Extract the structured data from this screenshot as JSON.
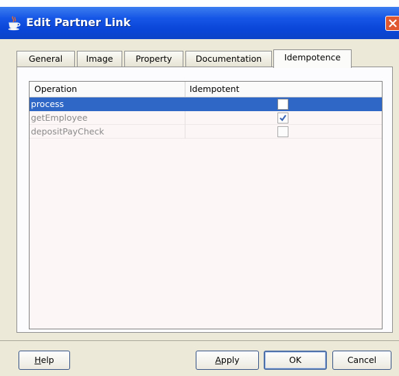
{
  "window": {
    "title": "Edit Partner Link"
  },
  "tabs": [
    "General",
    "Image",
    "Property",
    "Documentation",
    "Idempotence"
  ],
  "active_tab": "Idempotence",
  "table": {
    "columns": [
      "Operation",
      "Idempotent"
    ],
    "rows": [
      {
        "operation": "process",
        "idempotent": false,
        "selected": true
      },
      {
        "operation": "getEmployee",
        "idempotent": true,
        "selected": false
      },
      {
        "operation": "depositPayCheck",
        "idempotent": false,
        "selected": false
      }
    ]
  },
  "buttons": {
    "help": {
      "mnemonic": "H",
      "rest": "elp"
    },
    "apply": {
      "mnemonic": "A",
      "rest": "pply"
    },
    "ok": "OK",
    "cancel": "Cancel"
  },
  "colors": {
    "title_bar": "#0a46d8",
    "selection": "#2f67c7",
    "dialog_bg": "#ece9d8",
    "close_button": "#e0582f"
  }
}
